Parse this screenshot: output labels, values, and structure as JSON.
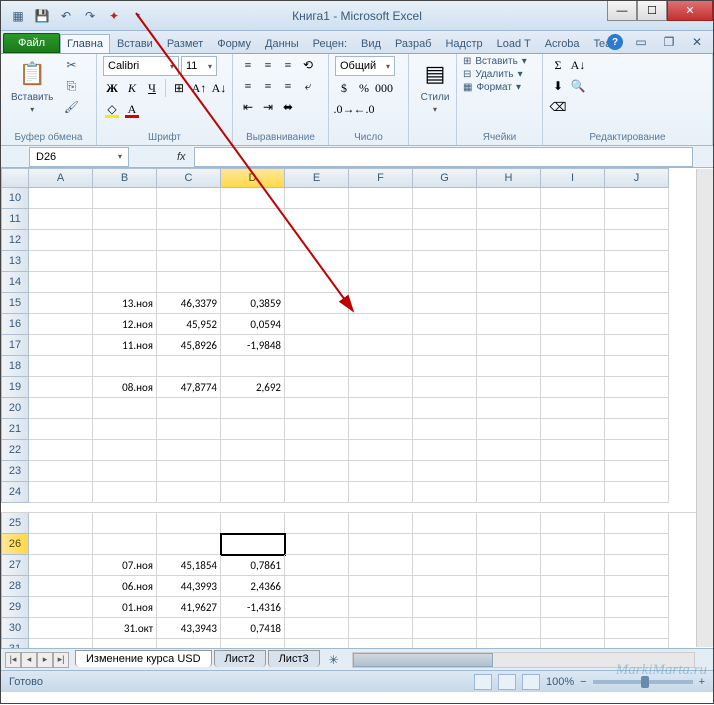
{
  "title": "Книга1 - Microsoft Excel",
  "tabs": {
    "file": "Файл",
    "list": [
      "Главна",
      "Встави",
      "Размет",
      "Форму",
      "Данны",
      "Рецен:",
      "Вид",
      "Разраб",
      "Надстр",
      "Load T",
      "Acroba",
      "Team"
    ],
    "active": 0
  },
  "ribbon": {
    "clipboard": {
      "paste": "Вставить",
      "label": "Буфер обмена"
    },
    "font": {
      "name": "Calibri",
      "size": "11",
      "bold": "Ж",
      "italic": "К",
      "underline": "Ч",
      "label": "Шрифт"
    },
    "align": {
      "label": "Выравнивание"
    },
    "number": {
      "format": "Общий",
      "label": "Число"
    },
    "styles": {
      "btn": "Стили",
      "label": ""
    },
    "cells": {
      "insert": "Вставить",
      "delete": "Удалить",
      "format": "Формат",
      "label": "Ячейки"
    },
    "editing": {
      "label": "Редактирование"
    }
  },
  "namebox": "D26",
  "fx": "fx",
  "columns": [
    "A",
    "B",
    "C",
    "D",
    "E",
    "F",
    "G",
    "H",
    "I",
    "J"
  ],
  "selected_col": 3,
  "selected_row_num": "26",
  "rows": [
    {
      "n": "10",
      "cells": [
        "",
        "",
        "",
        "",
        "",
        "",
        "",
        "",
        "",
        ""
      ]
    },
    {
      "n": "11",
      "cells": [
        "",
        "",
        "",
        "",
        "",
        "",
        "",
        "",
        "",
        ""
      ]
    },
    {
      "n": "12",
      "cells": [
        "",
        "",
        "",
        "",
        "",
        "",
        "",
        "",
        "",
        ""
      ]
    },
    {
      "n": "13",
      "cells": [
        "",
        "",
        "",
        "",
        "",
        "",
        "",
        "",
        "",
        ""
      ]
    },
    {
      "n": "14",
      "cells": [
        "",
        "",
        "",
        "",
        "",
        "",
        "",
        "",
        "",
        ""
      ]
    },
    {
      "n": "15",
      "cells": [
        "",
        "13.ноя",
        "46,3379",
        "0,3859",
        "",
        "",
        "",
        "",
        "",
        ""
      ]
    },
    {
      "n": "16",
      "cells": [
        "",
        "12.ноя",
        "45,952",
        "0,0594",
        "",
        "",
        "",
        "",
        "",
        ""
      ]
    },
    {
      "n": "17",
      "cells": [
        "",
        "11.ноя",
        "45,8926",
        "-1,9848",
        "",
        "",
        "",
        "",
        "",
        ""
      ]
    },
    {
      "n": "18",
      "cells": [
        "",
        "",
        "",
        "",
        "",
        "",
        "",
        "",
        "",
        ""
      ]
    },
    {
      "n": "19",
      "cells": [
        "",
        "08.ноя",
        "47,8774",
        "2,692",
        "",
        "",
        "",
        "",
        "",
        ""
      ]
    },
    {
      "n": "20",
      "cells": [
        "",
        "",
        "",
        "",
        "",
        "",
        "",
        "",
        "",
        ""
      ]
    },
    {
      "n": "21",
      "cells": [
        "",
        "",
        "",
        "",
        "",
        "",
        "",
        "",
        "",
        ""
      ]
    },
    {
      "n": "22",
      "cells": [
        "",
        "",
        "",
        "",
        "",
        "",
        "",
        "",
        "",
        ""
      ]
    },
    {
      "n": "23",
      "cells": [
        "",
        "",
        "",
        "",
        "",
        "",
        "",
        "",
        "",
        ""
      ]
    },
    {
      "n": "24",
      "cells": [
        "",
        "",
        "",
        "",
        "",
        "",
        "",
        "",
        "",
        ""
      ]
    },
    {
      "n": "25",
      "cells": [
        "",
        "",
        "",
        "",
        "",
        "",
        "",
        "",
        "",
        ""
      ]
    },
    {
      "n": "26",
      "cells": [
        "",
        "",
        "",
        "",
        "",
        "",
        "",
        "",
        "",
        ""
      ],
      "sel": 3
    },
    {
      "n": "27",
      "cells": [
        "",
        "07.ноя",
        "45,1854",
        "0,7861",
        "",
        "",
        "",
        "",
        "",
        ""
      ]
    },
    {
      "n": "28",
      "cells": [
        "",
        "06.ноя",
        "44,3993",
        "2,4366",
        "",
        "",
        "",
        "",
        "",
        ""
      ]
    },
    {
      "n": "29",
      "cells": [
        "",
        "01.ноя",
        "41,9627",
        "-1,4316",
        "",
        "",
        "",
        "",
        "",
        ""
      ]
    },
    {
      "n": "30",
      "cells": [
        "",
        "31.окт",
        "43,3943",
        "0,7418",
        "",
        "",
        "",
        "",
        "",
        ""
      ]
    },
    {
      "n": "31",
      "cells": [
        "",
        "",
        "",
        "",
        "",
        "",
        "",
        "",
        "",
        ""
      ]
    }
  ],
  "sheets": {
    "active": "Изменение курса USD",
    "others": [
      "Лист2",
      "Лист3"
    ]
  },
  "status": {
    "ready": "Готово",
    "zoom": "100%"
  },
  "watermark": "MarkiMarta.ru"
}
